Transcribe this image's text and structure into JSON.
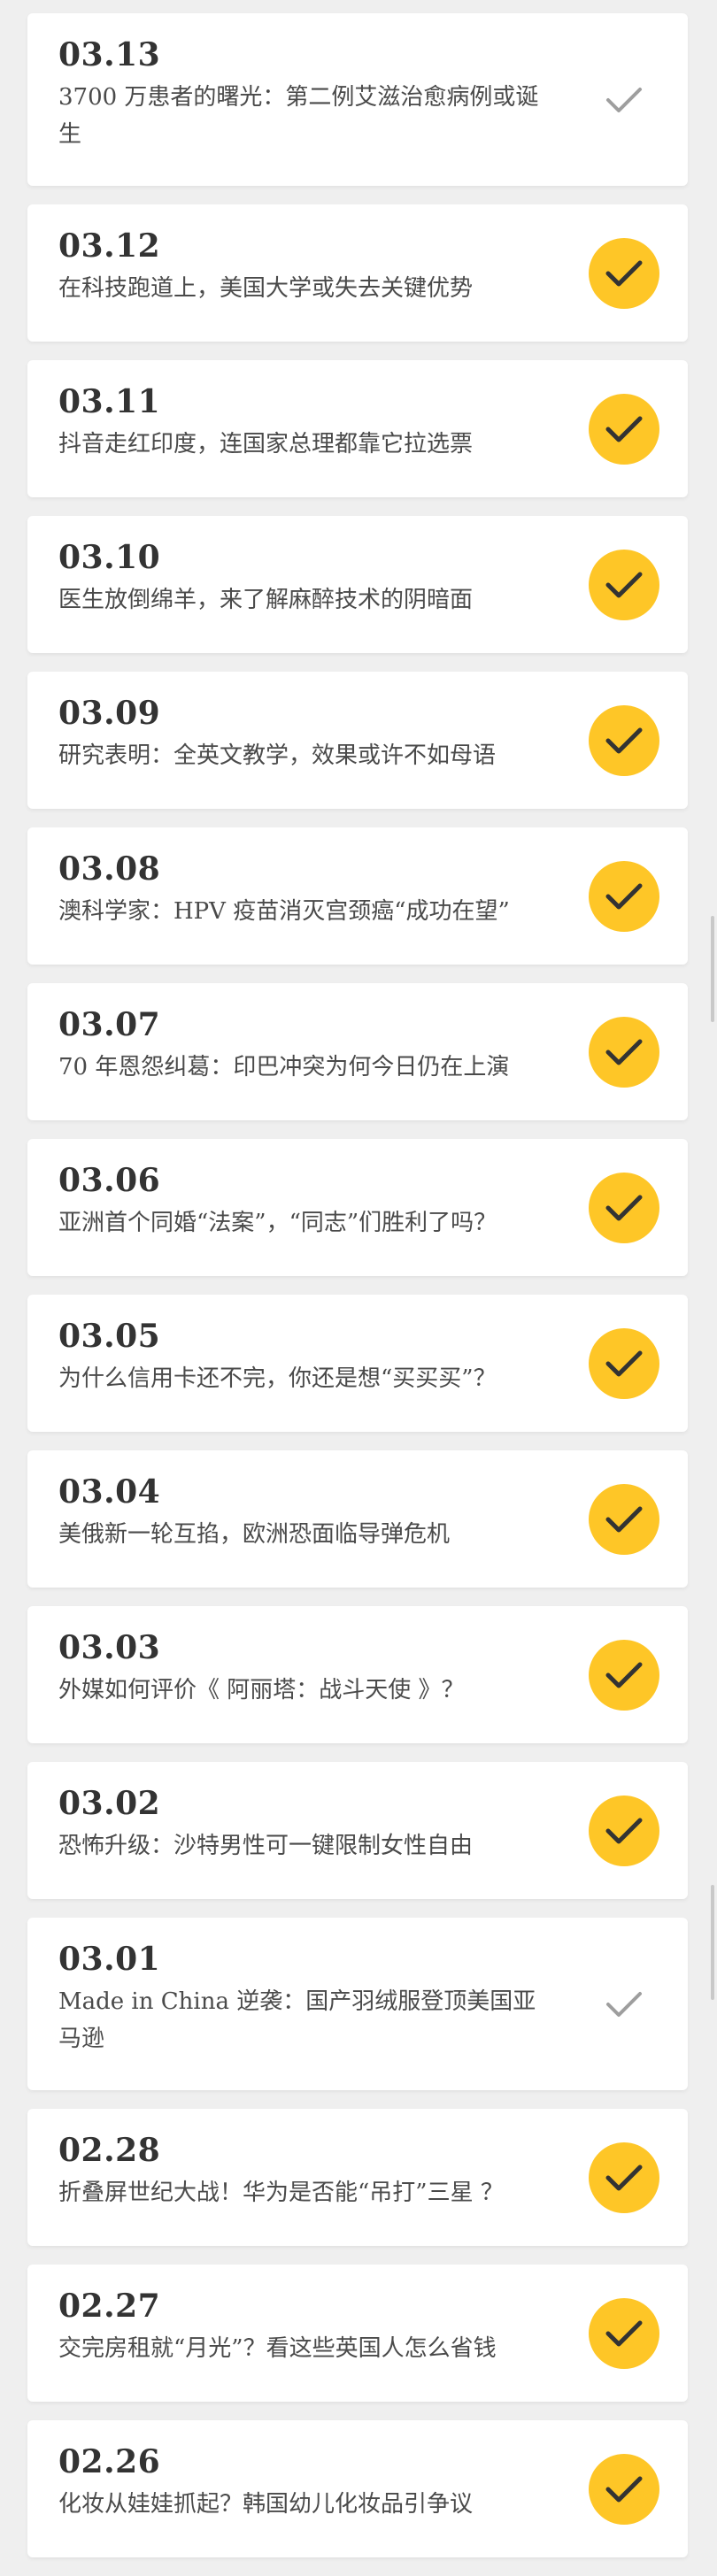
{
  "items": [
    {
      "date": "03.13",
      "title": "3700 万患者的曙光：第二例艾滋治愈病例或诞生",
      "read": false
    },
    {
      "date": "03.12",
      "title": "在科技跑道上，美国大学或失去关键优势",
      "read": true
    },
    {
      "date": "03.11",
      "title": "抖音走红印度，连国家总理都靠它拉选票",
      "read": true
    },
    {
      "date": "03.10",
      "title": "医生放倒绵羊，来了解麻醉技术的阴暗面",
      "read": true
    },
    {
      "date": "03.09",
      "title": "研究表明：全英文教学，效果或许不如母语",
      "read": true
    },
    {
      "date": "03.08",
      "title": "澳科学家：HPV 疫苗消灭宫颈癌“成功在望”",
      "read": true
    },
    {
      "date": "03.07",
      "title": "70 年恩怨纠葛：印巴冲突为何今日仍在上演",
      "read": true
    },
    {
      "date": "03.06",
      "title": "亚洲首个同婚“法案”，“同志”们胜利了吗？",
      "read": true
    },
    {
      "date": "03.05",
      "title": "为什么信用卡还不完，你还是想“买买买”？",
      "read": true
    },
    {
      "date": "03.04",
      "title": "美俄新一轮互掐，欧洲恐面临导弹危机",
      "read": true
    },
    {
      "date": "03.03",
      "title": "外媒如何评价《 阿丽塔：战斗天使 》？",
      "read": true
    },
    {
      "date": "03.02",
      "title": "恐怖升级：沙特男性可一键限制女性自由",
      "read": true
    },
    {
      "date": "03.01",
      "title": "Made in China 逆袭：国产羽绒服登顶美国亚马逊",
      "read": false
    },
    {
      "date": "02.28",
      "title": "折叠屏世纪大战！华为是否能“吊打”三星 ？",
      "read": true
    },
    {
      "date": "02.27",
      "title": "交完房租就“月光”？看这些英国人怎么省钱",
      "read": true
    },
    {
      "date": "02.26",
      "title": "化妆从娃娃抓起？韩国幼儿化妆品引争议",
      "read": true
    }
  ],
  "colors": {
    "accent": "#fec627",
    "check_dark": "#333333",
    "check_muted": "#9e9e9e",
    "background": "#efefef"
  },
  "icons": {
    "done": "check-circle-icon",
    "pending": "check-icon"
  }
}
